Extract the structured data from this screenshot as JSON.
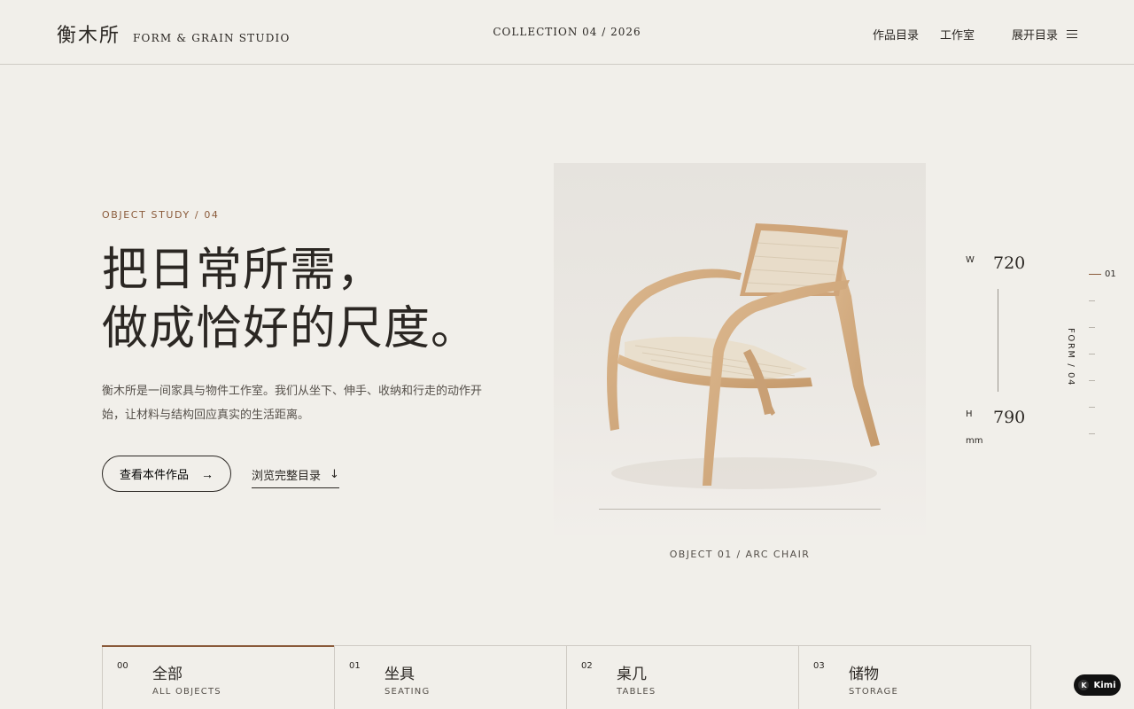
{
  "header": {
    "brand_cn": "衡木所",
    "brand_en": "FORM & GRAIN STUDIO",
    "collection": "COLLECTION 04 / 2026",
    "nav": [
      {
        "label": "作品目录"
      },
      {
        "label": "工作室"
      }
    ],
    "menu_label": "展开目录",
    "menu_icon": "hamburger-icon"
  },
  "hero": {
    "eyebrow": "OBJECT STUDY / 04",
    "headline_line1": "把日常所需，",
    "headline_line2": "做成恰好的尺度。",
    "description": "衡木所是一间家具与物件工作室。我们从坐下、伸手、收纳和行走的动作开始，让材料与结构回应真实的生活距离。",
    "primary_button": "查看本件作品",
    "primary_button_icon": "arrow-right-icon",
    "secondary_link": "浏览完整目录",
    "secondary_link_icon": "arrow-down-icon"
  },
  "feature": {
    "image_subject": "arc chair",
    "caption": "OBJECT 01 / ARC CHAIR",
    "dimensions": {
      "w_label": "W",
      "w_value": "720",
      "h_label": "H",
      "h_value": "790",
      "unit": "mm"
    }
  },
  "rail": {
    "current": "01",
    "vertical_label": "FORM / 04"
  },
  "categories": [
    {
      "num": "00",
      "cn": "全部",
      "en": "ALL OBJECTS",
      "active": true
    },
    {
      "num": "01",
      "cn": "坐具",
      "en": "SEATING",
      "active": false
    },
    {
      "num": "02",
      "cn": "桌几",
      "en": "TABLES",
      "active": false
    },
    {
      "num": "03",
      "cn": "储物",
      "en": "STORAGE",
      "active": false
    }
  ],
  "badge": {
    "label": "Kimi"
  },
  "colors": {
    "background": "#f1efea",
    "text": "#2b2723",
    "accent": "#8a5a3a",
    "rule": "#cfcbc4"
  }
}
